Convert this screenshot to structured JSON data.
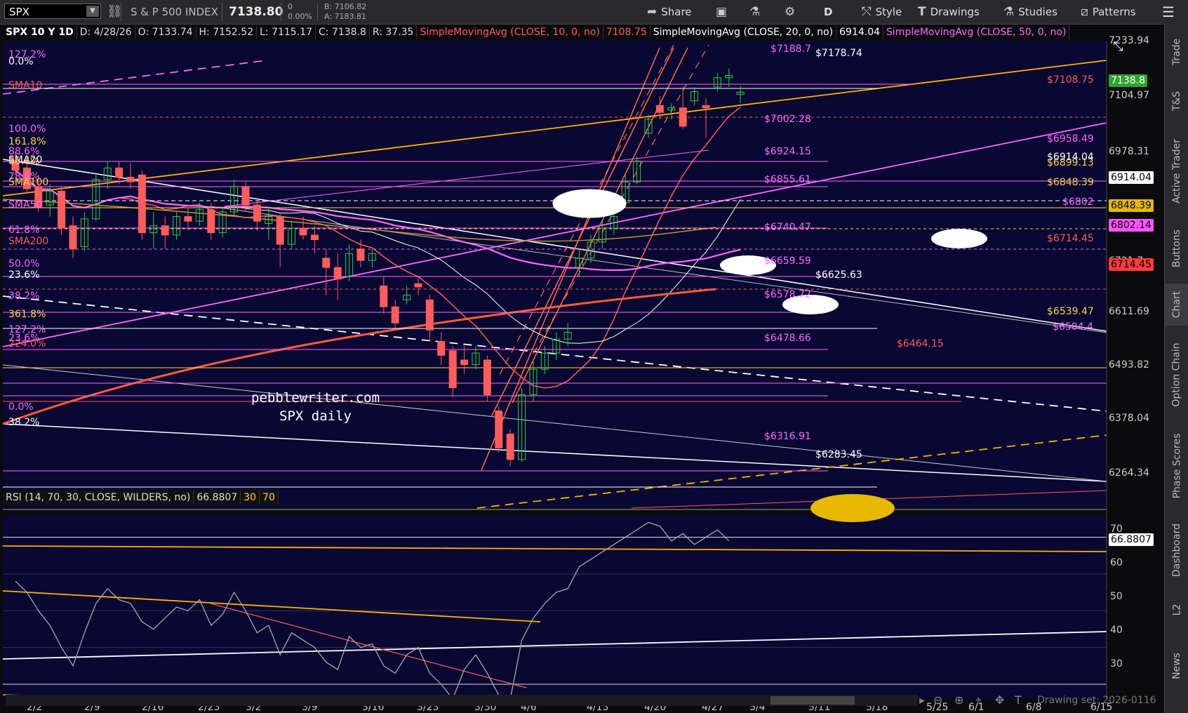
{
  "toolbar": {
    "symbol": "SPX",
    "symbol_name": "S & P 500 INDEX",
    "last_price": "7138.80",
    "change": "0",
    "change_pct": "0.00%",
    "bid": "B: 7106.82",
    "ask": "A: 7183.81",
    "share_label": "Share",
    "period_label": "D",
    "style_label": "Style",
    "drawings_label": "Drawings",
    "studies_label": "Studies",
    "patterns_label": "Patterns"
  },
  "sidebar": {
    "tabs": [
      "Trade",
      "T&S",
      "Active Trader",
      "Buttons",
      "Chart",
      "Option Chain",
      "Phase Scores",
      "Dashboard",
      "L2",
      "News"
    ],
    "active": "Chart"
  },
  "info_bar": {
    "title": "SPX 10 Y 1D",
    "date": "D: 4/28/26",
    "open": "O: 7133.74",
    "high": "H: 7152.52",
    "low": "L: 7115.17",
    "close": "C: 7138.8",
    "range": "R: 37.35",
    "sma10_label": "SimpleMovingAvg (CLOSE, 10, 0, no)",
    "sma10_value": "7108.75",
    "sma20_label": "SimpleMovingAvg (CLOSE, 20, 0, no)",
    "sma20_value": "6914.04",
    "sma50_label": "SimpleMovingAvg (CLOSE, 50, 0, no)",
    "colors": {
      "sma10": "#ff5a5a",
      "sma20": "#ffffff",
      "sma50": "#ff66ff"
    }
  },
  "rsi_bar": {
    "label": "RSI (14, 70, 30, CLOSE, WILDERS, no)",
    "value": "66.8807",
    "ob": "30",
    "os": "70"
  },
  "watermark": {
    "line1": "pebblewriter.com",
    "line2": "SPX daily"
  },
  "left_labels": [
    {
      "text": "127.2%",
      "color": "#ff66ff"
    },
    {
      "text": "0.0%",
      "color": "#ffffff"
    },
    {
      "text": "SMA10",
      "color": "#ff5a5a"
    },
    {
      "text": "100.0%",
      "color": "#ff66ff"
    },
    {
      "text": "161.8%",
      "color": "#ffd24a"
    },
    {
      "text": "88.6%",
      "color": "#ff66ff"
    },
    {
      "text": "SMA20",
      "color": "#ffffff"
    },
    {
      "text": "85.4%",
      "color": "#ffd24a"
    },
    {
      "text": "78.6%",
      "color": "#ff66ff"
    },
    {
      "text": "SMA100",
      "color": "#ffd24a"
    },
    {
      "text": "SMA50",
      "color": "#ff66ff"
    },
    {
      "text": "61.8%",
      "color": "#ff66ff"
    },
    {
      "text": "SMA200",
      "color": "#ff5a5a"
    },
    {
      "text": "50.0%",
      "color": "#ff66ff"
    },
    {
      "text": "23.6%",
      "color": "#ffffff"
    },
    {
      "text": "38.2%",
      "color": "#ff66ff"
    },
    {
      "text": "361.8%",
      "color": "#ffd24a"
    },
    {
      "text": "127.2%",
      "color": "#ff66ff"
    },
    {
      "text": "23.6%",
      "color": "#ff66ff"
    },
    {
      "text": "224.0%",
      "color": "#ff5a5a"
    },
    {
      "text": "0.0%",
      "color": "#ff66ff"
    },
    {
      "text": "38.2%",
      "color": "#ffffff"
    }
  ],
  "level_labels": [
    {
      "text": "$7188.7",
      "color": "#ff66ff"
    },
    {
      "text": "$7178.74",
      "color": "#ffffff"
    },
    {
      "text": "$7108.75",
      "color": "#ff5a5a"
    },
    {
      "text": "$7002.28",
      "color": "#ff66ff"
    },
    {
      "text": "$6958.49",
      "color": "#ff66ff"
    },
    {
      "text": "$6924.15",
      "color": "#ff66ff"
    },
    {
      "text": "$6914.04",
      "color": "#ffffff"
    },
    {
      "text": "$6899.13",
      "color": "#ffd24a"
    },
    {
      "text": "$6855.61",
      "color": "#ff66ff"
    },
    {
      "text": "$6848.39",
      "color": "#ffd24a"
    },
    {
      "text": "$6802",
      "color": "#ff66ff"
    },
    {
      "text": "$6740.47",
      "color": "#ff66ff"
    },
    {
      "text": "$6714.45",
      "color": "#ff5a5a"
    },
    {
      "text": "$6659.59",
      "color": "#ff66ff"
    },
    {
      "text": "$6625.63",
      "color": "#ffffff"
    },
    {
      "text": "$6578.72",
      "color": "#ff66ff"
    },
    {
      "text": "$6539.47",
      "color": "#ffd24a"
    },
    {
      "text": "$6504.4",
      "color": "#ff66ff"
    },
    {
      "text": "$6478.66",
      "color": "#ff66ff"
    },
    {
      "text": "$6464.15",
      "color": "#ff5a5a"
    },
    {
      "text": "$6316.91",
      "color": "#ff66ff"
    },
    {
      "text": "$6283.45",
      "color": "#ffffff"
    }
  ],
  "price_axis": [
    "7233.94",
    "7104.97",
    "6978.31",
    "6721.7",
    "6611.69",
    "6493.82",
    "6378.04",
    "6264.34"
  ],
  "price_tags": [
    {
      "text": "7138.8",
      "bg": "#2ea32e",
      "fg": "#ffffff"
    },
    {
      "text": "6914.04",
      "bg": "#ffffff",
      "fg": "#000000"
    },
    {
      "text": "6848.39",
      "bg": "#e6b800",
      "fg": "#000000"
    },
    {
      "text": "6802.14",
      "bg": "#ff55ff",
      "fg": "#000000"
    },
    {
      "text": "6714.45",
      "bg": "#ff3b3b",
      "fg": "#000000"
    }
  ],
  "rsi_axis": [
    "70",
    "60",
    "50",
    "40",
    "30"
  ],
  "rsi_tag": "66.8807",
  "date_axis": [
    "2/2",
    "2/9",
    "2/16",
    "2/23",
    "3/2",
    "3/9",
    "3/16",
    "3/23",
    "3/30",
    "4/6",
    "4/13",
    "4/20",
    "4/27",
    "5/4",
    "5/11",
    "5/18",
    "5/25",
    "6/1",
    "6/8",
    "6/15"
  ],
  "drawing_set": "Drawing set: 2026-0116",
  "chart_data": {
    "type": "candlestick",
    "candles": [
      {
        "d": "1/28",
        "o": 6990,
        "h": 7010,
        "l": 6960,
        "c": 6970
      },
      {
        "d": "1/29",
        "o": 6975,
        "h": 6985,
        "l": 6920,
        "c": 6930
      },
      {
        "d": "1/30",
        "o": 6935,
        "h": 6960,
        "l": 6880,
        "c": 6890
      },
      {
        "d": "2/2",
        "o": 6895,
        "h": 6940,
        "l": 6870,
        "c": 6925
      },
      {
        "d": "2/3",
        "o": 6925,
        "h": 6935,
        "l": 6830,
        "c": 6845
      },
      {
        "d": "2/4",
        "o": 6850,
        "h": 6870,
        "l": 6780,
        "c": 6800
      },
      {
        "d": "2/5",
        "o": 6805,
        "h": 6880,
        "l": 6795,
        "c": 6865
      },
      {
        "d": "2/6",
        "o": 6865,
        "h": 6960,
        "l": 6860,
        "c": 6950
      },
      {
        "d": "2/9",
        "o": 6950,
        "h": 6990,
        "l": 6930,
        "c": 6975
      },
      {
        "d": "2/10",
        "o": 6975,
        "h": 6990,
        "l": 6940,
        "c": 6955
      },
      {
        "d": "2/11",
        "o": 6955,
        "h": 6985,
        "l": 6930,
        "c": 6945
      },
      {
        "d": "2/12",
        "o": 6960,
        "h": 6970,
        "l": 6820,
        "c": 6835
      },
      {
        "d": "2/13",
        "o": 6835,
        "h": 6880,
        "l": 6800,
        "c": 6850
      },
      {
        "d": "2/17",
        "o": 6850,
        "h": 6870,
        "l": 6800,
        "c": 6830
      },
      {
        "d": "2/18",
        "o": 6830,
        "h": 6880,
        "l": 6820,
        "c": 6870
      },
      {
        "d": "2/19",
        "o": 6870,
        "h": 6890,
        "l": 6840,
        "c": 6860
      },
      {
        "d": "2/20",
        "o": 6860,
        "h": 6900,
        "l": 6850,
        "c": 6885
      },
      {
        "d": "2/23",
        "o": 6885,
        "h": 6900,
        "l": 6820,
        "c": 6835
      },
      {
        "d": "2/24",
        "o": 6835,
        "h": 6890,
        "l": 6825,
        "c": 6880
      },
      {
        "d": "2/25",
        "o": 6880,
        "h": 6950,
        "l": 6870,
        "c": 6935
      },
      {
        "d": "2/26",
        "o": 6935,
        "h": 6945,
        "l": 6880,
        "c": 6895
      },
      {
        "d": "2/27",
        "o": 6895,
        "h": 6910,
        "l": 6840,
        "c": 6860
      },
      {
        "d": "3/2",
        "o": 6855,
        "h": 6890,
        "l": 6820,
        "c": 6870
      },
      {
        "d": "3/3",
        "o": 6870,
        "h": 6875,
        "l": 6760,
        "c": 6810
      },
      {
        "d": "3/4",
        "o": 6810,
        "h": 6860,
        "l": 6800,
        "c": 6845
      },
      {
        "d": "3/5",
        "o": 6845,
        "h": 6870,
        "l": 6820,
        "c": 6830
      },
      {
        "d": "3/6",
        "o": 6830,
        "h": 6850,
        "l": 6790,
        "c": 6820
      },
      {
        "d": "3/9",
        "o": 6780,
        "h": 6800,
        "l": 6700,
        "c": 6760
      },
      {
        "d": "3/10",
        "o": 6760,
        "h": 6790,
        "l": 6690,
        "c": 6735
      },
      {
        "d": "3/11",
        "o": 6740,
        "h": 6810,
        "l": 6730,
        "c": 6790
      },
      {
        "d": "3/12",
        "o": 6800,
        "h": 6820,
        "l": 6760,
        "c": 6775
      },
      {
        "d": "3/13",
        "o": 6775,
        "h": 6800,
        "l": 6760,
        "c": 6790
      },
      {
        "d": "3/16",
        "o": 6720,
        "h": 6740,
        "l": 6660,
        "c": 6675
      },
      {
        "d": "3/17",
        "o": 6675,
        "h": 6690,
        "l": 6630,
        "c": 6640
      },
      {
        "d": "3/18",
        "o": 6690,
        "h": 6720,
        "l": 6680,
        "c": 6700
      },
      {
        "d": "3/19",
        "o": 6725,
        "h": 6740,
        "l": 6700,
        "c": 6718
      },
      {
        "d": "3/20",
        "o": 6690,
        "h": 6700,
        "l": 6600,
        "c": 6625
      },
      {
        "d": "3/23",
        "o": 6600,
        "h": 6620,
        "l": 6550,
        "c": 6570
      },
      {
        "d": "3/24",
        "o": 6580,
        "h": 6590,
        "l": 6480,
        "c": 6500
      },
      {
        "d": "3/25",
        "o": 6560,
        "h": 6590,
        "l": 6530,
        "c": 6550
      },
      {
        "d": "3/26",
        "o": 6550,
        "h": 6590,
        "l": 6540,
        "c": 6575
      },
      {
        "d": "3/27",
        "o": 6560,
        "h": 6570,
        "l": 6470,
        "c": 6485
      },
      {
        "d": "3/30",
        "o": 6450,
        "h": 6460,
        "l": 6360,
        "c": 6370
      },
      {
        "d": "3/31",
        "o": 6400,
        "h": 6410,
        "l": 6330,
        "c": 6345
      },
      {
        "d": "4/1",
        "o": 6345,
        "h": 6500,
        "l": 6340,
        "c": 6485
      },
      {
        "d": "4/2",
        "o": 6485,
        "h": 6560,
        "l": 6470,
        "c": 6540
      },
      {
        "d": "4/6",
        "o": 6540,
        "h": 6590,
        "l": 6530,
        "c": 6575
      },
      {
        "d": "4/7",
        "o": 6575,
        "h": 6620,
        "l": 6560,
        "c": 6605
      },
      {
        "d": "4/8",
        "o": 6605,
        "h": 6640,
        "l": 6590,
        "c": 6620
      },
      {
        "d": "4/9",
        "o": 6760,
        "h": 6800,
        "l": 6740,
        "c": 6780
      },
      {
        "d": "4/10",
        "o": 6780,
        "h": 6830,
        "l": 6770,
        "c": 6815
      },
      {
        "d": "4/13",
        "o": 6815,
        "h": 6860,
        "l": 6800,
        "c": 6845
      },
      {
        "d": "4/14",
        "o": 6845,
        "h": 6880,
        "l": 6830,
        "c": 6870
      },
      {
        "d": "4/15",
        "o": 6900,
        "h": 6960,
        "l": 6890,
        "c": 6945
      },
      {
        "d": "4/16",
        "o": 6945,
        "h": 7000,
        "l": 6940,
        "c": 6990
      },
      {
        "d": "4/17",
        "o": 7050,
        "h": 7090,
        "l": 7040,
        "c": 7080
      },
      {
        "d": "4/20",
        "o": 7110,
        "h": 7130,
        "l": 7080,
        "c": 7095
      },
      {
        "d": "4/21",
        "o": 7100,
        "h": 7115,
        "l": 7080,
        "c": 7105
      },
      {
        "d": "4/22",
        "o": 7105,
        "h": 7150,
        "l": 7060,
        "c": 7065
      },
      {
        "d": "4/23",
        "o": 7120,
        "h": 7150,
        "l": 7110,
        "c": 7140
      },
      {
        "d": "4/24",
        "o": 7110,
        "h": 7125,
        "l": 7040,
        "c": 7105
      },
      {
        "d": "4/27",
        "o": 7150,
        "h": 7180,
        "l": 7140,
        "c": 7170
      },
      {
        "d": "4/28",
        "o": 7170,
        "h": 7190,
        "l": 7150,
        "c": 7175
      },
      {
        "d": "4/29",
        "o": 7133.74,
        "h": 7152.52,
        "l": 7115.17,
        "c": 7138.8
      }
    ],
    "ylim": [
      6240,
      7250
    ],
    "rsi": [
      58,
      55,
      50,
      46,
      40,
      35,
      44,
      52,
      56,
      53,
      52,
      47,
      45,
      48,
      51,
      50,
      53,
      46,
      49,
      55,
      50,
      44,
      46,
      38,
      44,
      42,
      40,
      36,
      34,
      43,
      40,
      41,
      35,
      33,
      38,
      40,
      33,
      30,
      26,
      34,
      38,
      33,
      27,
      26,
      42,
      48,
      52,
      55,
      56,
      62,
      64,
      66,
      68,
      70,
      72,
      74,
      73,
      69,
      71,
      68,
      70,
      72,
      69
    ],
    "rsi_ylim": [
      26,
      76
    ]
  }
}
